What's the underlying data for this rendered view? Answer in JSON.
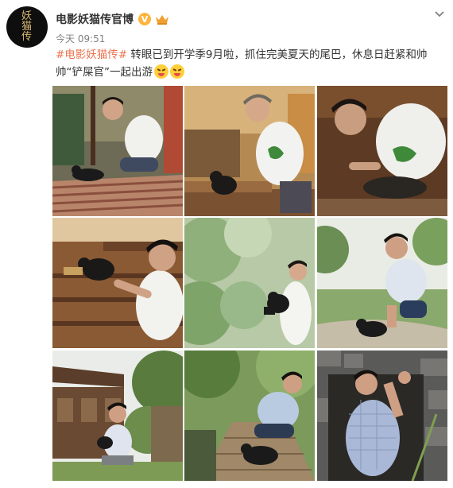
{
  "account": {
    "avatar_text": [
      "妖",
      "猫",
      "传"
    ],
    "name": "电影妖猫传官博",
    "verified_mark": "V",
    "vip_icon": "vip-crown-icon"
  },
  "post": {
    "timestamp": "今天 09:51",
    "hashtag": "#电影妖猫传#",
    "body": " 转眼已到开学季9月啦，抓住完美夏天的尾巴，休息日赶紧和帅帅“铲屎官”一起出游",
    "emojis": [
      "grin-squint-emoji",
      "grin-squint-emoji"
    ]
  },
  "menu": {
    "icon": "chevron-down-icon"
  },
  "photos": [
    {
      "name": "photo-1",
      "scene": "man sitting on striped rug petting black cat"
    },
    {
      "name": "photo-2",
      "scene": "man in cap leaning over cat on wooden bench"
    },
    {
      "name": "photo-3",
      "scene": "close-up man stroking cat on wooden table"
    },
    {
      "name": "photo-4",
      "scene": "man holding up cat by wooden pavilion"
    },
    {
      "name": "photo-5",
      "scene": "man holding black cat in green trees"
    },
    {
      "name": "photo-6",
      "scene": "man crouching next to cat on stone path"
    },
    {
      "name": "photo-7",
      "scene": "man sitting under tree by old house with cat"
    },
    {
      "name": "photo-8",
      "scene": "man crouching on boardwalk with cat"
    },
    {
      "name": "photo-9",
      "scene": "man in plaid shirt standing by stone wall"
    }
  ],
  "colors": {
    "hashtag": "#eb7350",
    "text": "#333333",
    "meta": "#808080",
    "verified": "#ffb43c"
  }
}
